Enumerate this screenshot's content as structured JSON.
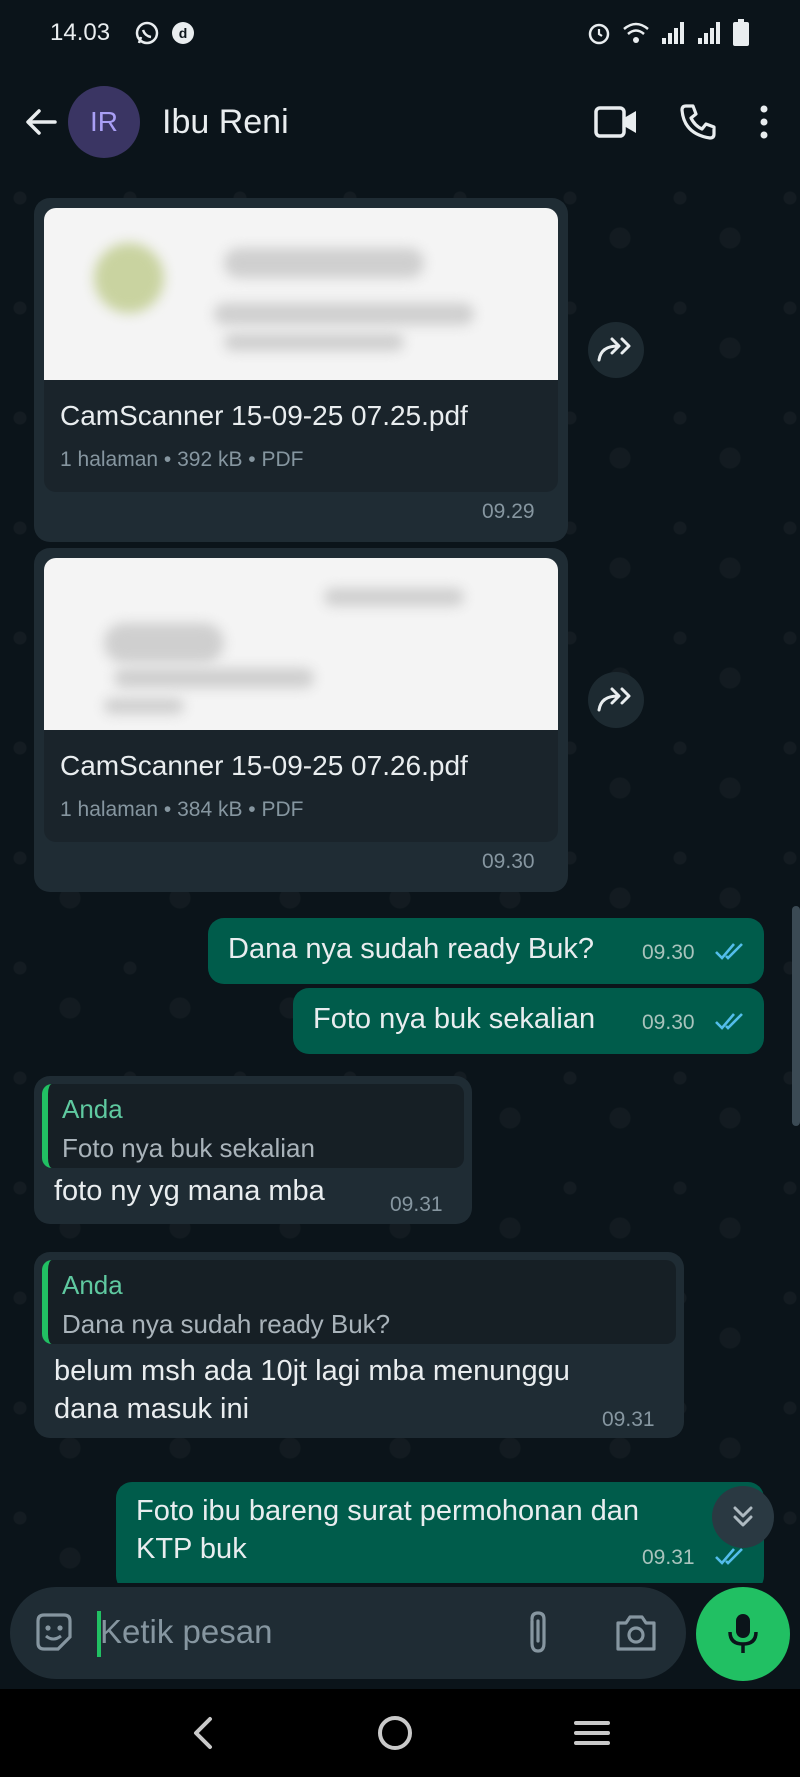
{
  "status_bar": {
    "time": "14.03"
  },
  "header": {
    "avatar_initials": "IR",
    "contact_name": "Ibu Reni",
    "icons": [
      "back-arrow-icon",
      "video-call-icon",
      "phone-icon",
      "more-vert-icon"
    ]
  },
  "messages": [
    {
      "type": "document",
      "direction": "in",
      "file_name": "CamScanner 15-09-25 07.25.pdf",
      "meta": "1 halaman • 392 kB • PDF",
      "time": "09.29"
    },
    {
      "type": "document",
      "direction": "in",
      "file_name": "CamScanner 15-09-25 07.26.pdf",
      "meta": "1 halaman • 384 kB • PDF",
      "time": "09.30"
    },
    {
      "type": "text",
      "direction": "out",
      "text": "Dana nya sudah ready Buk?",
      "time": "09.30",
      "status": "read"
    },
    {
      "type": "text",
      "direction": "out",
      "text": "Foto nya buk sekalian",
      "time": "09.30",
      "status": "read"
    },
    {
      "type": "reply",
      "direction": "in",
      "quote_author": "Anda",
      "quote_text": "Foto nya buk sekalian",
      "text": "foto ny yg mana mba",
      "time": "09.31"
    },
    {
      "type": "reply",
      "direction": "in",
      "quote_author": "Anda",
      "quote_text": "Dana nya sudah ready Buk?",
      "text_line1": "belum msh ada 10jt lagi mba menunggu",
      "text_line2": "dana masuk ini",
      "time": "09.31"
    },
    {
      "type": "text",
      "direction": "out",
      "text_line1": "Foto ibu bareng surat permohonan dan",
      "text_line2": "KTP buk",
      "time": "09.31",
      "status": "read"
    }
  ],
  "composer": {
    "placeholder": "Ketik pesan",
    "icons": [
      "sticker-icon",
      "attach-icon",
      "camera-icon",
      "mic-icon"
    ]
  },
  "colors": {
    "background": "#0b141a",
    "incoming_bubble": "#1f2c34",
    "outgoing_bubble": "#005c4b",
    "accent": "#21c063",
    "read_tick": "#53bdeb"
  }
}
